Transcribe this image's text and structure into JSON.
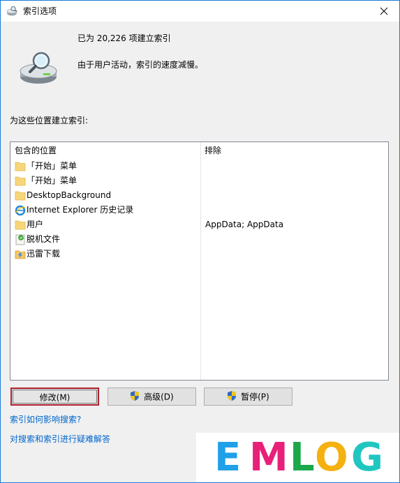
{
  "window": {
    "title": "索引选项",
    "title_icon": "indexing-options-icon",
    "close_icon": "close-icon"
  },
  "status": {
    "icon": "indexing-drive-magnifier-icon",
    "count_text": "已为 20,226 项建立索引",
    "message": "由于用户活动，索引的速度减慢。"
  },
  "locations": {
    "section_label": "为这些位置建立索引:",
    "columns": {
      "included": "包含的位置",
      "exclude": "排除"
    },
    "rows": [
      {
        "name": "「开始」菜单",
        "exclude": "",
        "icon": "folder-icon"
      },
      {
        "name": "「开始」菜单",
        "exclude": "",
        "icon": "folder-icon"
      },
      {
        "name": "DesktopBackground",
        "exclude": "",
        "icon": "folder-icon"
      },
      {
        "name": "Internet Explorer 历史记录",
        "exclude": "",
        "icon": "internet-explorer-icon"
      },
      {
        "name": "用户",
        "exclude": "AppData; AppData",
        "icon": "folder-icon"
      },
      {
        "name": "脱机文件",
        "exclude": "",
        "icon": "offline-files-icon"
      },
      {
        "name": "迅雷下载",
        "exclude": "",
        "icon": "xunlei-download-icon"
      }
    ]
  },
  "buttons": {
    "modify": "修改(M)",
    "advanced": "高级(D)",
    "pause": "暂停(P)"
  },
  "links": {
    "how_indexing_affects_search": "索引如何影响搜索?",
    "troubleshoot": "对搜索和索引进行疑难解答"
  },
  "watermark": {
    "text": "EMLOG",
    "letters": [
      "E",
      "M",
      "L",
      "O",
      "G"
    ],
    "colors": [
      "#1fa0e8",
      "#e8207a",
      "#1aa84b",
      "#f4b10f",
      "#20c6c0"
    ]
  },
  "colors": {
    "focus_border": "#b0202e",
    "link": "#0066cc",
    "window_border": "#1b79d6"
  }
}
